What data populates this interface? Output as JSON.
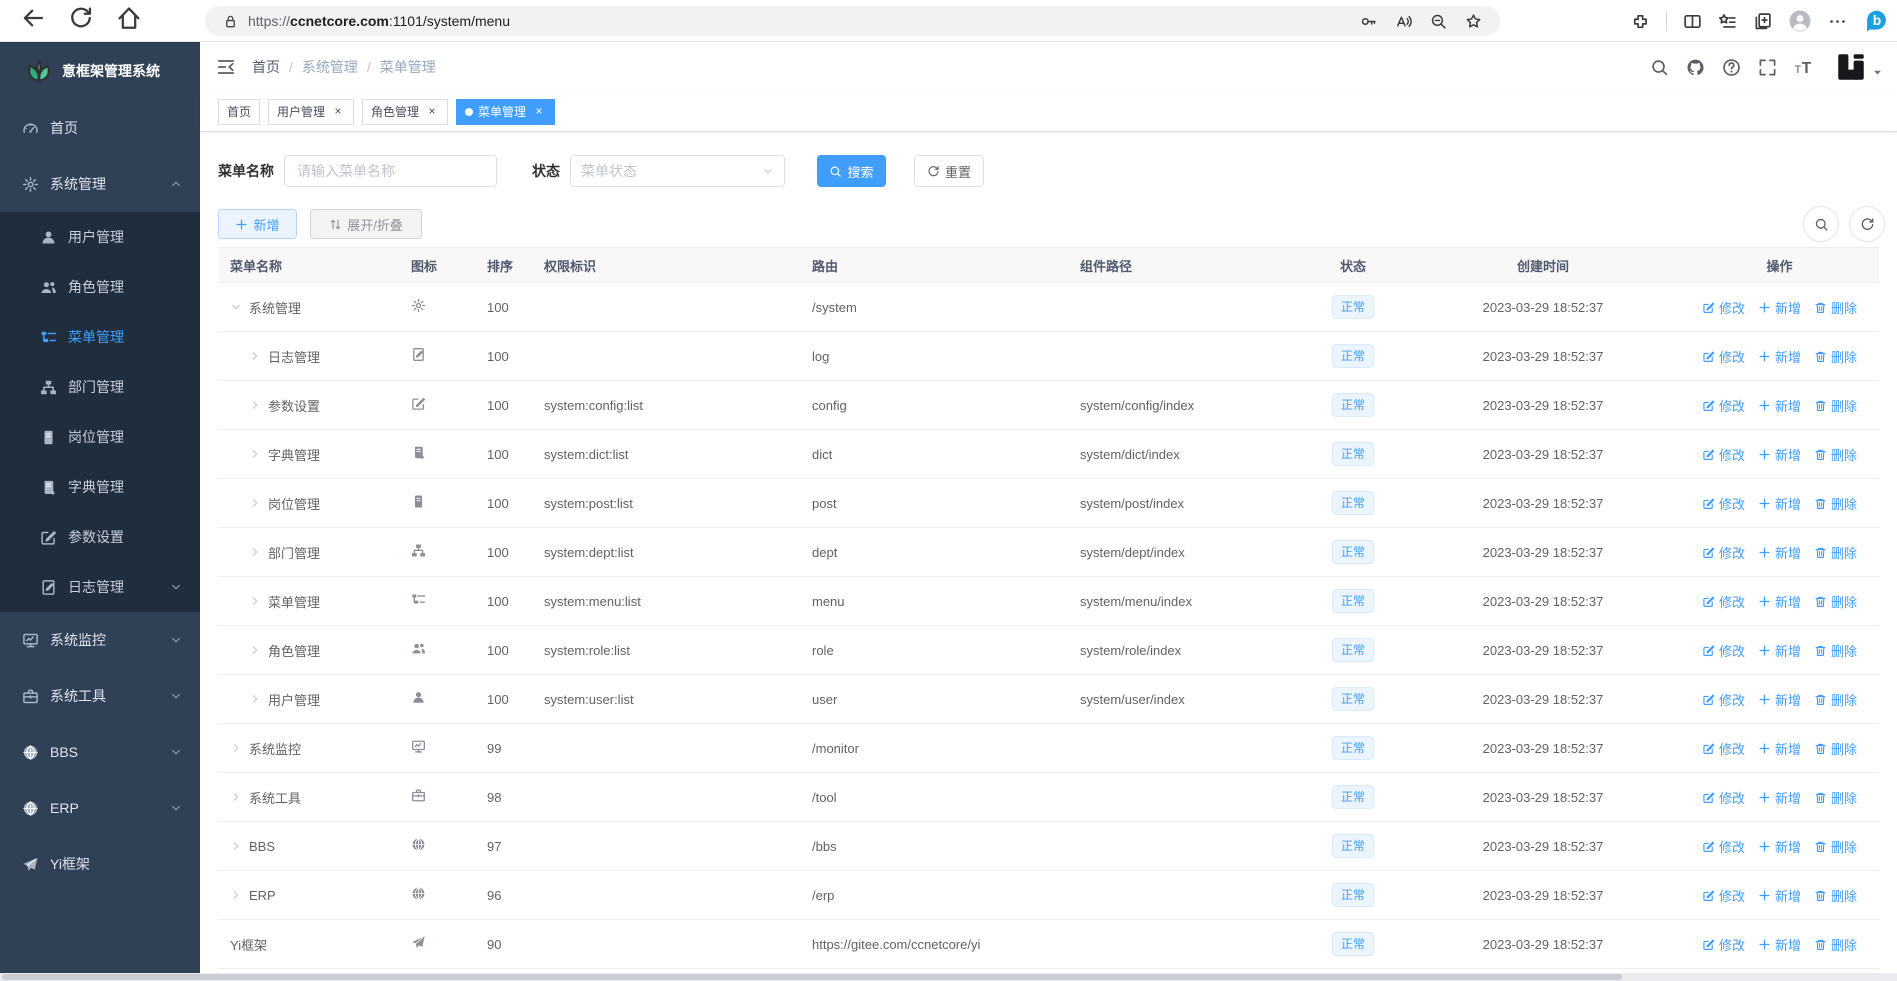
{
  "browser": {
    "url_scheme": "https://",
    "url_host": "ccnetcore.com",
    "url_rest": ":1101/system/menu",
    "left_icons": [
      "back-arrow",
      "refresh",
      "home"
    ],
    "pill_icons": [
      "key",
      "read-aloud",
      "zoom-out",
      "favorite-star"
    ],
    "right_icons": [
      "extensions",
      "divider",
      "split-screen",
      "favorites",
      "collections",
      "profile-avatar",
      "more-ellipsis",
      "bing-copilot"
    ]
  },
  "sidebar": {
    "logo_title": "意框架管理系统",
    "items": [
      {
        "label": "首页",
        "icon": "dashboard",
        "level": "top"
      },
      {
        "label": "系统管理",
        "icon": "gear",
        "level": "top",
        "chevron": "up"
      },
      {
        "label": "用户管理",
        "icon": "user",
        "level": "sub"
      },
      {
        "label": "角色管理",
        "icon": "users",
        "level": "sub"
      },
      {
        "label": "菜单管理",
        "icon": "tree-table",
        "level": "sub",
        "active": true
      },
      {
        "label": "部门管理",
        "icon": "org-tree",
        "level": "sub"
      },
      {
        "label": "岗位管理",
        "icon": "id-card",
        "level": "sub"
      },
      {
        "label": "字典管理",
        "icon": "dict-book",
        "level": "sub"
      },
      {
        "label": "参数设置",
        "icon": "edit-square",
        "level": "sub"
      },
      {
        "label": "日志管理",
        "icon": "log-doc",
        "level": "sub",
        "chevron": "down"
      },
      {
        "label": "系统监控",
        "icon": "monitor",
        "level": "top",
        "chevron": "down"
      },
      {
        "label": "系统工具",
        "icon": "toolbox",
        "level": "top",
        "chevron": "down"
      },
      {
        "label": "BBS",
        "icon": "globe",
        "level": "top",
        "chevron": "down"
      },
      {
        "label": "ERP",
        "icon": "globe",
        "level": "top",
        "chevron": "down"
      },
      {
        "label": "Yi框架",
        "icon": "paper-plane",
        "level": "top"
      }
    ]
  },
  "header": {
    "breadcrumb": [
      "首页",
      "系统管理",
      "菜单管理"
    ],
    "right_icons": [
      "search",
      "github",
      "question",
      "fullscreen",
      "font-size"
    ]
  },
  "tabs": [
    {
      "label": "首页",
      "closable": false,
      "active": false
    },
    {
      "label": "用户管理",
      "closable": true,
      "active": false
    },
    {
      "label": "角色管理",
      "closable": true,
      "active": false
    },
    {
      "label": "菜单管理",
      "closable": true,
      "active": true
    }
  ],
  "filters": {
    "name_label": "菜单名称",
    "name_placeholder": "请输入菜单名称",
    "status_label": "状态",
    "status_placeholder": "菜单状态",
    "search_label": "搜索",
    "reset_label": "重置"
  },
  "toolbar": {
    "add_label": "新增",
    "toggle_label": "展开/折叠"
  },
  "table": {
    "columns": [
      "菜单名称",
      "图标",
      "排序",
      "权限标识",
      "路由",
      "组件路径",
      "状态",
      "创建时间",
      "操作"
    ],
    "action_labels": {
      "edit": "修改",
      "add": "新增",
      "delete": "删除"
    },
    "rows": [
      {
        "name": "系统管理",
        "level": 0,
        "expand": "down",
        "icon": "gear",
        "order": "100",
        "perms": "",
        "path": "/system",
        "component": "",
        "status": "正常",
        "created": "2023-03-29 18:52:37"
      },
      {
        "name": "日志管理",
        "level": 1,
        "expand": "right",
        "icon": "log-doc",
        "order": "100",
        "perms": "",
        "path": "log",
        "component": "",
        "status": "正常",
        "created": "2023-03-29 18:52:37"
      },
      {
        "name": "参数设置",
        "level": 1,
        "expand": "right",
        "icon": "edit-square",
        "order": "100",
        "perms": "system:config:list",
        "path": "config",
        "component": "system/config/index",
        "status": "正常",
        "created": "2023-03-29 18:52:37"
      },
      {
        "name": "字典管理",
        "level": 1,
        "expand": "right",
        "icon": "dict-book",
        "order": "100",
        "perms": "system:dict:list",
        "path": "dict",
        "component": "system/dict/index",
        "status": "正常",
        "created": "2023-03-29 18:52:37"
      },
      {
        "name": "岗位管理",
        "level": 1,
        "expand": "right",
        "icon": "id-card",
        "order": "100",
        "perms": "system:post:list",
        "path": "post",
        "component": "system/post/index",
        "status": "正常",
        "created": "2023-03-29 18:52:37"
      },
      {
        "name": "部门管理",
        "level": 1,
        "expand": "right",
        "icon": "org-tree",
        "order": "100",
        "perms": "system:dept:list",
        "path": "dept",
        "component": "system/dept/index",
        "status": "正常",
        "created": "2023-03-29 18:52:37"
      },
      {
        "name": "菜单管理",
        "level": 1,
        "expand": "right",
        "icon": "tree-table",
        "order": "100",
        "perms": "system:menu:list",
        "path": "menu",
        "component": "system/menu/index",
        "status": "正常",
        "created": "2023-03-29 18:52:37"
      },
      {
        "name": "角色管理",
        "level": 1,
        "expand": "right",
        "icon": "users",
        "order": "100",
        "perms": "system:role:list",
        "path": "role",
        "component": "system/role/index",
        "status": "正常",
        "created": "2023-03-29 18:52:37"
      },
      {
        "name": "用户管理",
        "level": 1,
        "expand": "right",
        "icon": "user",
        "order": "100",
        "perms": "system:user:list",
        "path": "user",
        "component": "system/user/index",
        "status": "正常",
        "created": "2023-03-29 18:52:37"
      },
      {
        "name": "系统监控",
        "level": 0,
        "expand": "right",
        "icon": "monitor",
        "order": "99",
        "perms": "",
        "path": "/monitor",
        "component": "",
        "status": "正常",
        "created": "2023-03-29 18:52:37"
      },
      {
        "name": "系统工具",
        "level": 0,
        "expand": "right",
        "icon": "toolbox",
        "order": "98",
        "perms": "",
        "path": "/tool",
        "component": "",
        "status": "正常",
        "created": "2023-03-29 18:52:37"
      },
      {
        "name": "BBS",
        "level": 0,
        "expand": "right",
        "icon": "globe",
        "order": "97",
        "perms": "",
        "path": "/bbs",
        "component": "",
        "status": "正常",
        "created": "2023-03-29 18:52:37"
      },
      {
        "name": "ERP",
        "level": 0,
        "expand": "right",
        "icon": "globe",
        "order": "96",
        "perms": "",
        "path": "/erp",
        "component": "",
        "status": "正常",
        "created": "2023-03-29 18:52:37"
      },
      {
        "name": "Yi框架",
        "level": 0,
        "expand": "none",
        "icon": "paper-plane",
        "order": "90",
        "perms": "",
        "path": "https://gitee.com/ccnetcore/yi",
        "component": "",
        "status": "正常",
        "created": "2023-03-29 18:52:37"
      }
    ]
  },
  "colors": {
    "accent": "#409eff",
    "sidebar_bg": "#304156",
    "submenu_bg": "#1f2d3d",
    "tag_bg": "#ecf5ff"
  }
}
